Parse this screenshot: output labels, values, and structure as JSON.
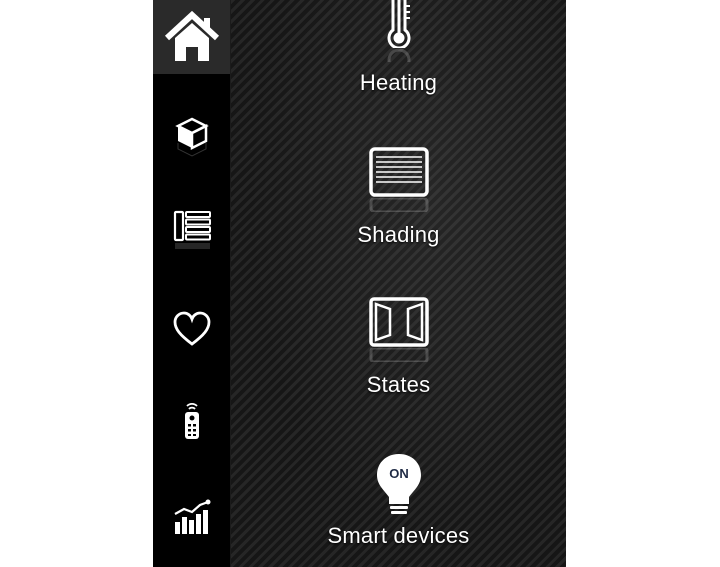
{
  "sidebar": {
    "items": [
      {
        "name": "home",
        "icon": "home-icon",
        "active": true
      },
      {
        "name": "rooms",
        "icon": "cube-icon",
        "active": false
      },
      {
        "name": "functions",
        "icon": "functions-list-icon",
        "active": false
      },
      {
        "name": "favorites",
        "icon": "heart-icon",
        "active": false
      },
      {
        "name": "remote",
        "icon": "remote-control-icon",
        "active": false
      },
      {
        "name": "statistics",
        "icon": "chart-icon",
        "active": false
      }
    ]
  },
  "main": {
    "tiles": [
      {
        "label": "Heating",
        "icon": "thermometer-icon"
      },
      {
        "label": "Shading",
        "icon": "shutter-icon"
      },
      {
        "label": "States",
        "icon": "window-icon"
      },
      {
        "label": "Smart devices",
        "icon": "bulb-on-icon",
        "badge": "ON"
      }
    ]
  },
  "colors": {
    "foreground": "#ffffff",
    "sidebar_bg": "#000000",
    "active_item_bg": "#2a2a2a",
    "badge_text": "#1f2a44"
  }
}
